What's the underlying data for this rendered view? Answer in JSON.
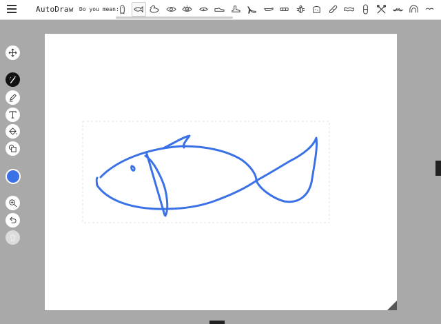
{
  "app": {
    "title": "AutoDraw"
  },
  "suggestions": {
    "label": "Do you mean:",
    "items": [
      "penguin-icon",
      "fish-icon",
      "duck-icon",
      "eye-icon",
      "eyeball-icon",
      "eye-outline-icon",
      "sneaker-icon",
      "boot-icon",
      "high-heel-icon",
      "whistle-icon",
      "bandage-icon",
      "bug-icon",
      "bread-icon",
      "bandaid-icon",
      "bacon-icon",
      "pill-icon",
      "scissors-icon",
      "mustache-icon",
      "arch-icon",
      "bird-icon"
    ]
  },
  "tools": [
    "move-icon",
    "autodraw-icon",
    "draw-icon",
    "type-icon",
    "fill-icon",
    "shape-icon",
    "color-picker",
    "zoom-icon",
    "undo-icon",
    "delete-icon"
  ],
  "colors": {
    "stroke": "#3b71e6",
    "selected_fill": "#3b71e6"
  }
}
